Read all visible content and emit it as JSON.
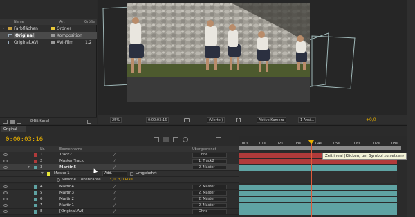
{
  "project": {
    "columns": {
      "name": "Name",
      "type": "Art",
      "size": "Größe"
    },
    "items": [
      {
        "name": "Farbflächen",
        "type": "Ordner",
        "size": "",
        "swatch": "#e8c838",
        "icon": "folder-icon"
      },
      {
        "name": "Original",
        "type": "Komposition",
        "size": "",
        "swatch": "#9a9a9a",
        "icon": "composition-icon",
        "selected": true
      },
      {
        "name": "Original.AVI",
        "type": "AVI-Film",
        "size": "1,2",
        "swatch": "#9a9a9a",
        "icon": "film-icon"
      }
    ],
    "bit_depth": "8-Bit-Kanal"
  },
  "viewer": {
    "zoom": "25%",
    "time": "0:00:03:16",
    "resolution": "(Viertel)",
    "camera": "Aktive Kamera",
    "views": "1 Ansi...",
    "exposure": "+0,0"
  },
  "timeline": {
    "tab": "Original",
    "timecode": "0:00:03:16",
    "columns": {
      "num": "Nr.",
      "name": "Ebenenname",
      "parent": "Übergeordnet"
    },
    "ruler_ticks": [
      "00s",
      "01s",
      "02s",
      "03s",
      "04s",
      "05s",
      "06s",
      "07s",
      "08s"
    ],
    "layers": [
      {
        "num": "1",
        "name": "Track2",
        "parent": "Ohne",
        "swatch": "#ffffff",
        "bar": "#b03a3a"
      },
      {
        "num": "2",
        "name": "Master Track",
        "parent": "1. Track2",
        "swatch": "#ffffff",
        "bar": "#b03a3a"
      },
      {
        "num": "3",
        "name": "Martin5",
        "parent": "2. Master",
        "swatch": "#5fa3a3",
        "bar": "#5fa3a3",
        "selected": true
      },
      {
        "num": "",
        "name": "Maske 1",
        "parent": "",
        "mask": true,
        "mode": "Add.",
        "inverted": "Umgekehrt"
      },
      {
        "num": "",
        "name": "Weiche ...okenkante",
        "parent": "",
        "feather": "3,0, 3,0 Pixel"
      },
      {
        "num": "4",
        "name": "Martin4",
        "parent": "2. Master",
        "swatch": "#5fa3a3",
        "bar": "#5fa3a3"
      },
      {
        "num": "5",
        "name": "Martin3",
        "parent": "2. Master",
        "swatch": "#5fa3a3",
        "bar": "#5fa3a3"
      },
      {
        "num": "6",
        "name": "Martin2",
        "parent": "2. Master",
        "swatch": "#5fa3a3",
        "bar": "#5fa3a3"
      },
      {
        "num": "7",
        "name": "Martin1",
        "parent": "2. Master",
        "swatch": "#5fa3a3",
        "bar": "#5fa3a3"
      },
      {
        "num": "8",
        "name": "[Original.AVI]",
        "parent": "Ohne",
        "swatch": "#5fa3a3",
        "bar": "#5fa3a3"
      }
    ],
    "tooltip": "Zeitlineal (Klicken, um Symbol zu setzen)"
  },
  "colors": {
    "timecode": "#e8b000",
    "cti": "#e05a3a"
  }
}
